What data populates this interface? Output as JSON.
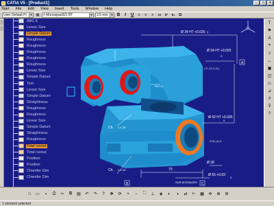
{
  "window": {
    "title": "CATIA V5 - [Product1]"
  },
  "menu": [
    "Start",
    "File",
    "Edit",
    "View",
    "Insert",
    "Tools",
    "Window",
    "Help"
  ],
  "toolbar": {
    "view_combo": "User Default Pr",
    "standard_combo": "# Monospac821 BT",
    "size_combo": "3.5 mm",
    "bold": "B",
    "italic": "I",
    "underline": "U"
  },
  "tree": {
    "items": [
      {
        "label": "ABC.5",
        "icon": "datum"
      },
      {
        "label": "Linear Size",
        "icon": "node"
      },
      {
        "label": "Simple Datum",
        "icon": "datum",
        "selected": true
      },
      {
        "label": "Roughness",
        "icon": "roughness"
      },
      {
        "label": "Roughness",
        "icon": "roughness"
      },
      {
        "label": "Roughness",
        "icon": "roughness"
      },
      {
        "label": "Roughness",
        "icon": "roughness"
      },
      {
        "label": "Roughness",
        "icon": "roughness"
      },
      {
        "label": "Linear Size",
        "icon": "node"
      },
      {
        "label": "Simple Datum",
        "icon": "datum"
      },
      {
        "label": "Text",
        "icon": "node"
      },
      {
        "label": "Linear Size",
        "icon": "node"
      },
      {
        "label": "Simple Datum",
        "icon": "datum"
      },
      {
        "label": "Straightness",
        "icon": "node"
      },
      {
        "label": "Roughness",
        "icon": "roughness"
      },
      {
        "label": "Roughness",
        "icon": "roughness"
      },
      {
        "label": "Linear Size",
        "icon": "node"
      },
      {
        "label": "Simple Datum",
        "icon": "datum"
      },
      {
        "label": "Straightness",
        "icon": "node"
      },
      {
        "label": "Roughness",
        "icon": "roughness"
      },
      {
        "label": "Total runout",
        "icon": "toler",
        "selected": true
      },
      {
        "label": "Total runout",
        "icon": "toler"
      },
      {
        "label": "Position",
        "icon": "node"
      },
      {
        "label": "Position",
        "icon": "node"
      },
      {
        "label": "Chamfer Dim",
        "icon": "node"
      },
      {
        "label": "Chamfer Dim",
        "icon": "node"
      }
    ]
  },
  "annotations": {
    "dim_top": "Ø 34 H7 +0.025",
    "dim_top_tol": "0",
    "dim_tol_frame": "| ⊙ | 0.1 | A |",
    "dim_right_top": "Ø 34 H7 +0.025",
    "dim_right_zero": "0",
    "dim_ch1": "Ch.",
    "dim_ch1_val": "1 x 30°",
    "dim_ch2": "Ch.",
    "dim_ch2_val": "1 x 30°",
    "dim_mid_right": "Ø 42 H7 +0.025",
    "dim_mid_right_zero": "0",
    "dim_70": "70",
    "dim_bottom_1": "Ø 30",
    "dim_bottom_2": "Ø 55 +0.03",
    "dim_bottom_2_zero": "0",
    "dim_bottom_label": "SUR BOSSAGES",
    "dim_frame_bottom": "0.01 | A-C",
    "datum_b": "B",
    "datum_c": "C",
    "datum_a": "A",
    "dim_ra": "Ra 3.2"
  },
  "status": {
    "text": "1 element selected"
  },
  "colors": {
    "viewport": "#1a1c86",
    "part": "#2a9fd8",
    "bore_highlight": "#e01818",
    "bore_orange": "#f07820",
    "selection": "#e89a3c"
  }
}
